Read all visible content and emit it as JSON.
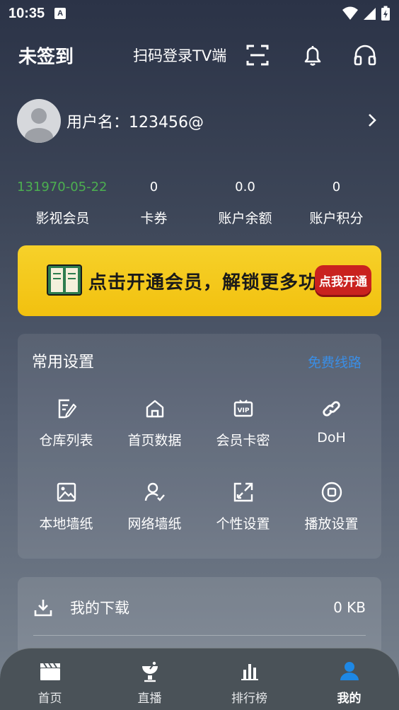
{
  "status": {
    "time": "10:35",
    "badge": "A"
  },
  "header": {
    "title": "未签到",
    "scan_label": "扫码登录TV端",
    "icons": [
      "scan-icon",
      "bell-icon",
      "headset-icon"
    ]
  },
  "user": {
    "username": "用户名：123456@"
  },
  "stats": [
    {
      "value": "131970-05-22",
      "label": "影视会员"
    },
    {
      "value": "0",
      "label": "卡券"
    },
    {
      "value": "0.0",
      "label": "账户余额"
    },
    {
      "value": "0",
      "label": "账户积分"
    }
  ],
  "banner": {
    "text": "点击开通会员，解锁更多功能",
    "cta": "点我开通"
  },
  "settings": {
    "title": "常用设置",
    "link": "免费线路",
    "items": [
      {
        "label": "仓库列表",
        "icon": "edit-doc-icon"
      },
      {
        "label": "首页数据",
        "icon": "home-icon"
      },
      {
        "label": "会员卡密",
        "icon": "vip-card-icon"
      },
      {
        "label": "DoH",
        "icon": "link-icon"
      },
      {
        "label": "本地墙纸",
        "icon": "image-icon"
      },
      {
        "label": "网络墙纸",
        "icon": "user-check-icon"
      },
      {
        "label": "个性设置",
        "icon": "expand-icon"
      },
      {
        "label": "播放设置",
        "icon": "stop-circle-icon"
      }
    ]
  },
  "downloads": {
    "label": "我的下载",
    "size": "0 KB"
  },
  "tabbar": [
    {
      "label": "首页",
      "icon": "clapperboard-icon"
    },
    {
      "label": "直播",
      "icon": "satellite-icon"
    },
    {
      "label": "排行榜",
      "icon": "bar-chart-icon"
    },
    {
      "label": "我的",
      "icon": "person-icon",
      "active": true
    }
  ],
  "colors": {
    "accent_link": "#3a8ee6",
    "vip_green": "#4caf50",
    "banner_yellow": "#f4c81a",
    "cta_red": "#c9221f"
  }
}
